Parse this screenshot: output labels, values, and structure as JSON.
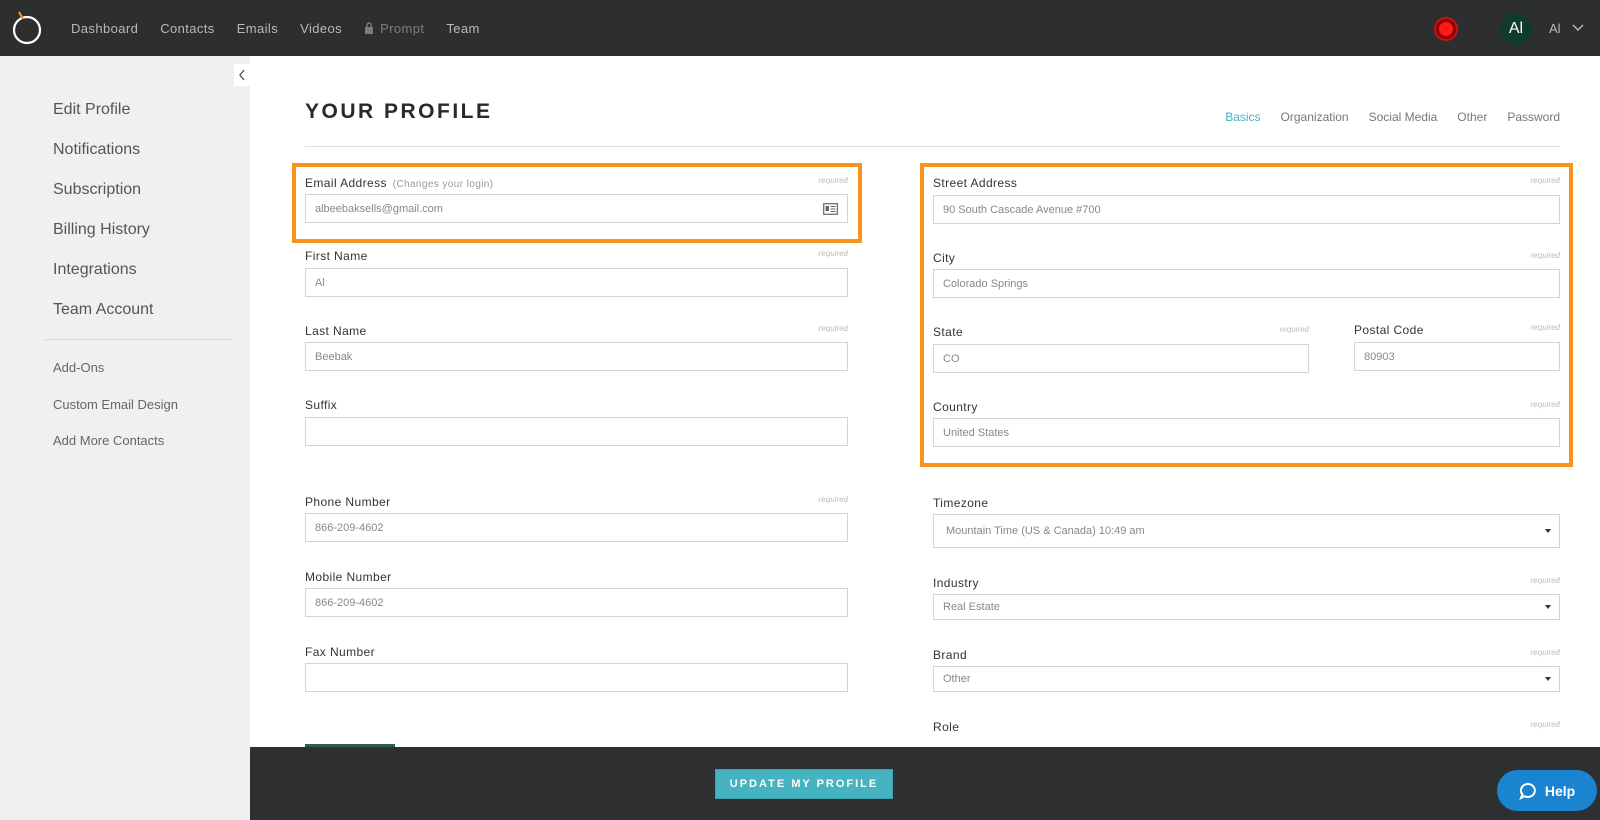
{
  "nav": {
    "items": [
      {
        "label": "Dashboard"
      },
      {
        "label": "Contacts"
      },
      {
        "label": "Emails"
      },
      {
        "label": "Videos"
      },
      {
        "label": "Prompt",
        "locked": true
      },
      {
        "label": "Team"
      }
    ],
    "avatar_initials": "Al",
    "user_name": "Al",
    "record_color": "#ff1a1a"
  },
  "sidebar": {
    "main_items": [
      {
        "label": "Edit Profile"
      },
      {
        "label": "Notifications"
      },
      {
        "label": "Subscription"
      },
      {
        "label": "Billing History"
      },
      {
        "label": "Integrations"
      },
      {
        "label": "Team Account"
      }
    ],
    "sub_items": [
      {
        "label": "Add-Ons"
      },
      {
        "label": "Custom Email Design"
      },
      {
        "label": "Add More Contacts"
      }
    ]
  },
  "page": {
    "title": "YOUR PROFILE",
    "tabs": [
      {
        "label": "Basics",
        "active": true
      },
      {
        "label": "Organization"
      },
      {
        "label": "Social Media"
      },
      {
        "label": "Other"
      },
      {
        "label": "Password"
      }
    ]
  },
  "form": {
    "required_text": "required",
    "email": {
      "label": "Email Address",
      "hint": "(Changes your login)",
      "value": "albeebaksells@gmail.com"
    },
    "first_name": {
      "label": "First Name",
      "value": "Al"
    },
    "last_name": {
      "label": "Last Name",
      "value": "Beebak"
    },
    "suffix": {
      "label": "Suffix",
      "value": ""
    },
    "phone": {
      "label": "Phone Number",
      "value": "866-209-4602"
    },
    "mobile": {
      "label": "Mobile Number",
      "value": "866-209-4602"
    },
    "fax": {
      "label": "Fax Number",
      "value": ""
    },
    "street": {
      "label": "Street Address",
      "value": "90 South Cascade Avenue #700"
    },
    "city": {
      "label": "City",
      "value": "Colorado Springs"
    },
    "state": {
      "label": "State",
      "value": "CO"
    },
    "postal": {
      "label": "Postal Code",
      "value": "80903"
    },
    "country": {
      "label": "Country",
      "value": "United States"
    },
    "timezone": {
      "label": "Timezone",
      "value": "Mountain Time (US & Canada) 10:49 am"
    },
    "industry": {
      "label": "Industry",
      "value": "Real Estate"
    },
    "brand": {
      "label": "Brand",
      "value": "Other"
    },
    "role": {
      "label": "Role"
    }
  },
  "highlight_color": "#f7931e",
  "accent_color": "#46b3c0",
  "footer": {
    "update_button": "UPDATE MY PROFILE",
    "help_button": "Help"
  }
}
